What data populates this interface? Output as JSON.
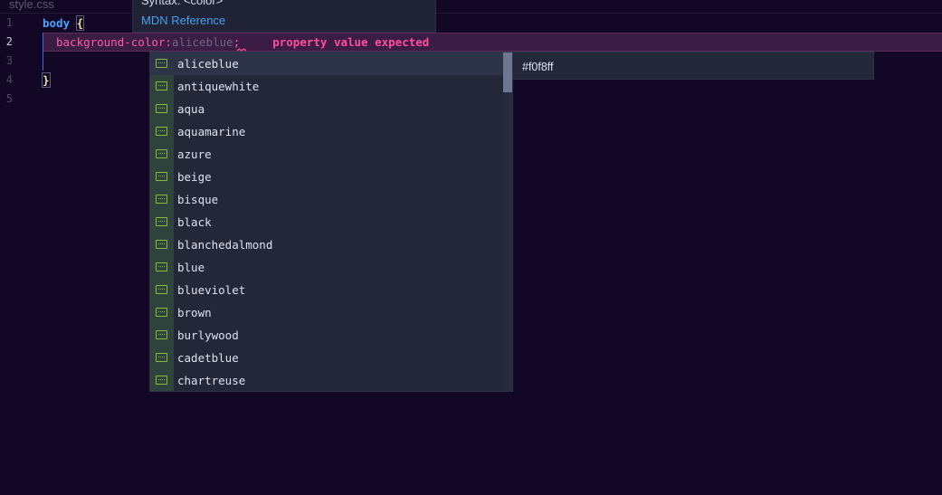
{
  "file": {
    "tab_title": "style.css"
  },
  "editor": {
    "line_numbers": [
      "1",
      "2",
      "3",
      "4",
      "5"
    ],
    "active_line": 2,
    "line1": {
      "selector": "body",
      "brace": "{"
    },
    "line2": {
      "property": "background-color",
      "colon": ":",
      "ghost_value": "aliceblue",
      "semicolon": ";",
      "error": "property value expected"
    },
    "line4": {
      "brace": "}"
    }
  },
  "hover": {
    "syntax": "Syntax: <color>",
    "mdn_link": "MDN Reference"
  },
  "suggest": {
    "selected_index": 0,
    "items": [
      "aliceblue",
      "antiquewhite",
      "aqua",
      "aquamarine",
      "azure",
      "beige",
      "bisque",
      "black",
      "blanchedalmond",
      "blue",
      "blueviolet",
      "brown",
      "burlywood",
      "cadetblue",
      "chartreuse"
    ],
    "item_icon": "value-icon"
  },
  "details": {
    "value": "#f0f8ff"
  },
  "colors": {
    "background": "#130726",
    "selector": "#4aa3ff",
    "property": "#ff5da2",
    "error": "#ff4e9a",
    "link": "#4aa0f0",
    "icon": "#7fbf3a"
  }
}
